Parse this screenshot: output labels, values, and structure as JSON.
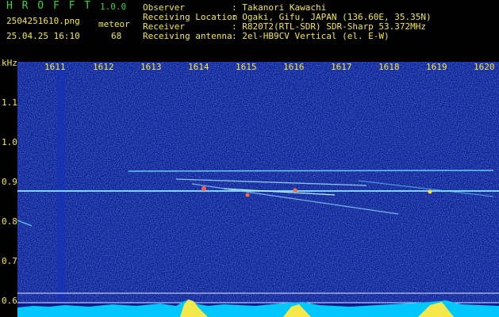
{
  "app": {
    "title": "H R O F F T",
    "version": "1.0.0",
    "filename": "2504251610.png",
    "datetime": "25.04.25 16:10",
    "detection_label": "meteor",
    "detection_count": "68"
  },
  "info": {
    "observer_label": "Observer",
    "observer_value": ": Takanori Kawachi",
    "location_label": "Receiving Location",
    "location_value": ": Ogaki, Gifu, JAPAN (136.60E, 35.35N)",
    "receiver_label": "Receiver",
    "receiver_value": ": R820T2(RTL-SDR) SDR-Sharp 53.372MHz",
    "antenna_label": "Receiving antenna",
    "antenna_value": ": 2el-HB9CV Vertical (el. E-W)"
  },
  "axes": {
    "y_unit": "kHz",
    "x_ticks": [
      "1611",
      "1612",
      "1613",
      "1614",
      "1615",
      "1616",
      "1617",
      "1618",
      "1619",
      "1620"
    ],
    "y_ticks": [
      "1.1",
      "1.0",
      "0.9",
      "0.8",
      "0.7",
      "0.6"
    ]
  },
  "colors": {
    "background": "#000000",
    "spectrum_bg": "#0a1a8c",
    "carrier": "#7fd0ff",
    "level_bar": "#00c8ff",
    "label_yellow": "#f4e84a",
    "title_green": "#3ad23a"
  }
}
